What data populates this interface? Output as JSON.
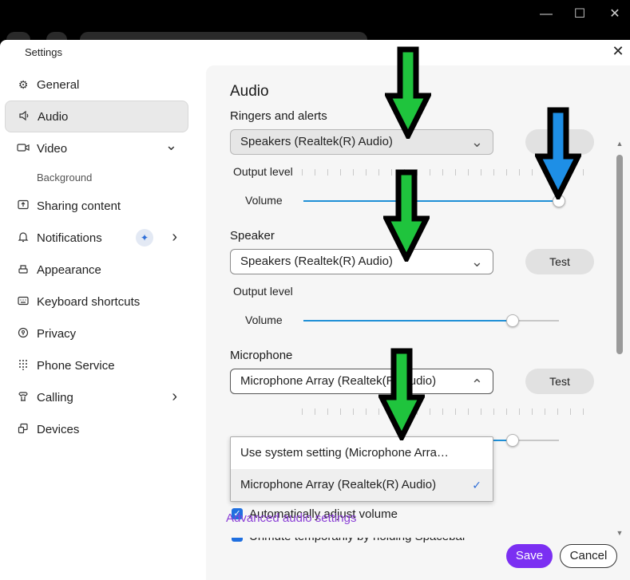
{
  "window": {
    "title": "Settings",
    "close_glyph": "✕",
    "os_controls": [
      "—",
      "☐",
      "✕"
    ]
  },
  "nav": {
    "items": [
      {
        "label": "General",
        "icon": "gear-icon",
        "glyph": "⚙"
      },
      {
        "label": "Audio",
        "icon": "speaker-icon",
        "glyph": "🔈",
        "active": true
      },
      {
        "label": "Video",
        "icon": "video-icon",
        "glyph": "▭",
        "chevron": "⌄"
      },
      {
        "label": "Sharing content",
        "icon": "share-icon",
        "glyph": "⇪"
      },
      {
        "label": "Notifications",
        "icon": "bell-icon",
        "glyph": "🔔",
        "chevron": "›"
      },
      {
        "label": "Appearance",
        "icon": "appearance-icon",
        "glyph": "⌨"
      },
      {
        "label": "Keyboard shortcuts",
        "icon": "keyboard-icon",
        "glyph": "⌨"
      },
      {
        "label": "Privacy",
        "icon": "privacy-icon",
        "glyph": "Ⓑ"
      },
      {
        "label": "Phone Service",
        "icon": "dialpad-icon",
        "glyph": "⁞"
      },
      {
        "label": "Calling",
        "icon": "phone-icon",
        "glyph": "☏",
        "chevron": "›"
      },
      {
        "label": "Devices",
        "icon": "devices-icon",
        "glyph": "⧉"
      }
    ],
    "video_sub": "Background",
    "sparkle": "✦"
  },
  "audio": {
    "title": "Audio",
    "ringers": {
      "title": "Ringers and alerts",
      "device": "Speakers (Realtek(R) Audio)",
      "chevron": "⌄",
      "output_label": "Output level",
      "volume_label": "Volume",
      "volume": 1.0,
      "test_label": "Test"
    },
    "speaker": {
      "title": "Speaker",
      "device": "Speakers (Realtek(R) Audio)",
      "chevron": "⌄",
      "test_label": "Test",
      "output_label": "Output level",
      "volume_label": "Volume",
      "volume": 0.82
    },
    "microphone": {
      "title": "Microphone",
      "device": "Microphone Array (Realtek(R) Audio)",
      "chevron": "⌃",
      "test_label": "Test",
      "menu": [
        {
          "label": "Use system setting (Microphone Arra…",
          "selected": false
        },
        {
          "label": "Microphone Array (Realtek(R) Audio)",
          "selected": true
        }
      ],
      "check_glyph": "✓",
      "volume": 0.82
    },
    "checkboxes": [
      {
        "label": "Automatically adjust volume",
        "checked": true
      },
      {
        "label": "Unmute temporarily by holding Spacebar",
        "checked": true
      }
    ],
    "check_glyph": "✓",
    "advanced_link": "Advanced audio settings"
  },
  "footer": {
    "save": "Save",
    "cancel": "Cancel"
  },
  "colors": {
    "accent": "#7b2ff2",
    "slider_fill": "#1f8fd6",
    "link": "#8a3ed6",
    "annotation_green": "#1fc43d",
    "annotation_blue": "#1e8fe6"
  }
}
